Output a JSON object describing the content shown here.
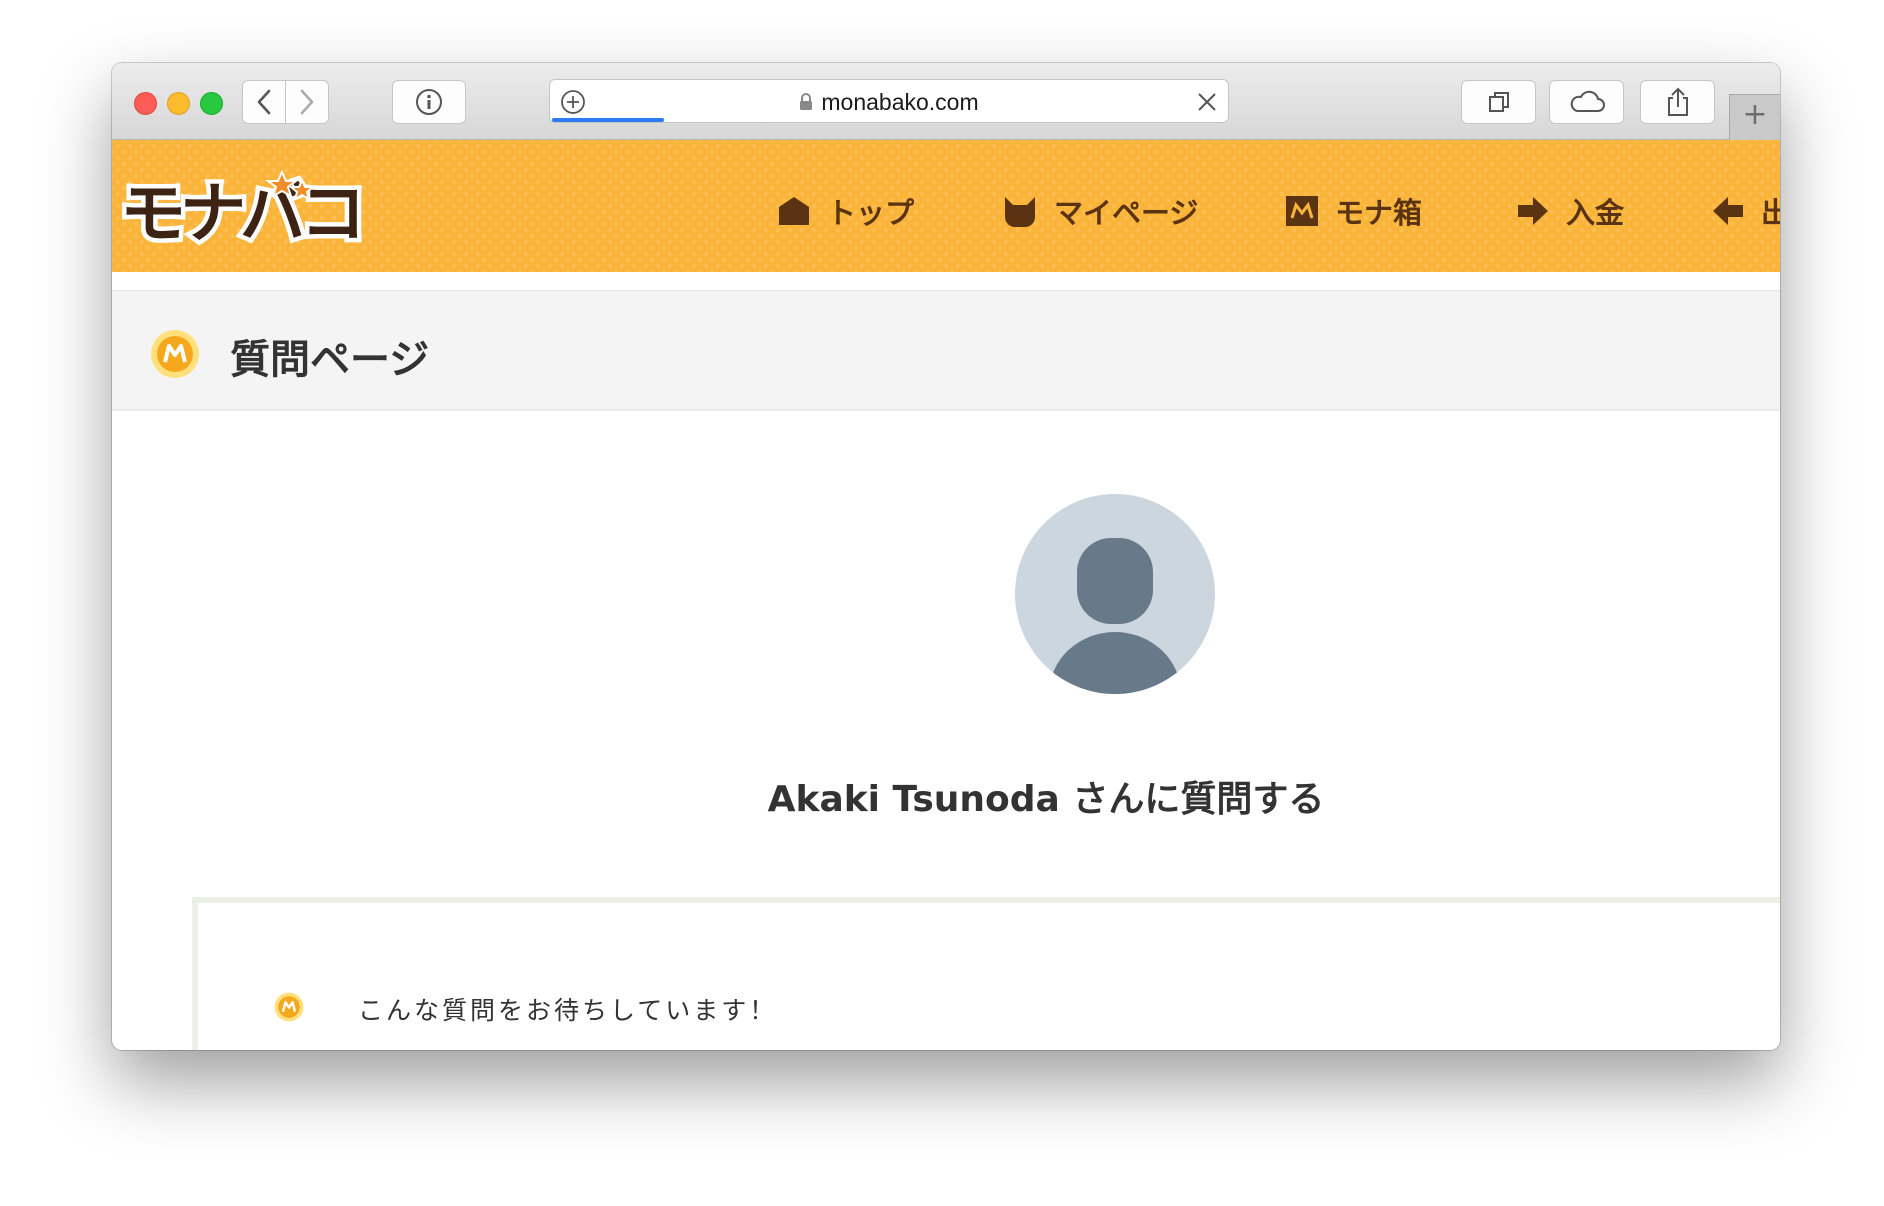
{
  "browser": {
    "url": "monabako.com",
    "new_tab_label": "+"
  },
  "site": {
    "logo_text": "モナバコ",
    "nav": [
      {
        "label": "トップ",
        "icon": "house-icon"
      },
      {
        "label": "マイページ",
        "icon": "cat-icon"
      },
      {
        "label": "モナ箱",
        "icon": "mona-box-icon"
      },
      {
        "label": "入金",
        "icon": "arrow-right-icon"
      },
      {
        "label": "出",
        "icon": "arrow-left-icon"
      }
    ],
    "colors": {
      "header": "#fbb43a",
      "nav_text": "#5a3312",
      "logo_fill": "#3d2314"
    }
  },
  "page": {
    "title": "質問ページ",
    "heading": "Akaki Tsunoda さんに質問する",
    "card_text": "こんな質問をお待ちしています！"
  }
}
